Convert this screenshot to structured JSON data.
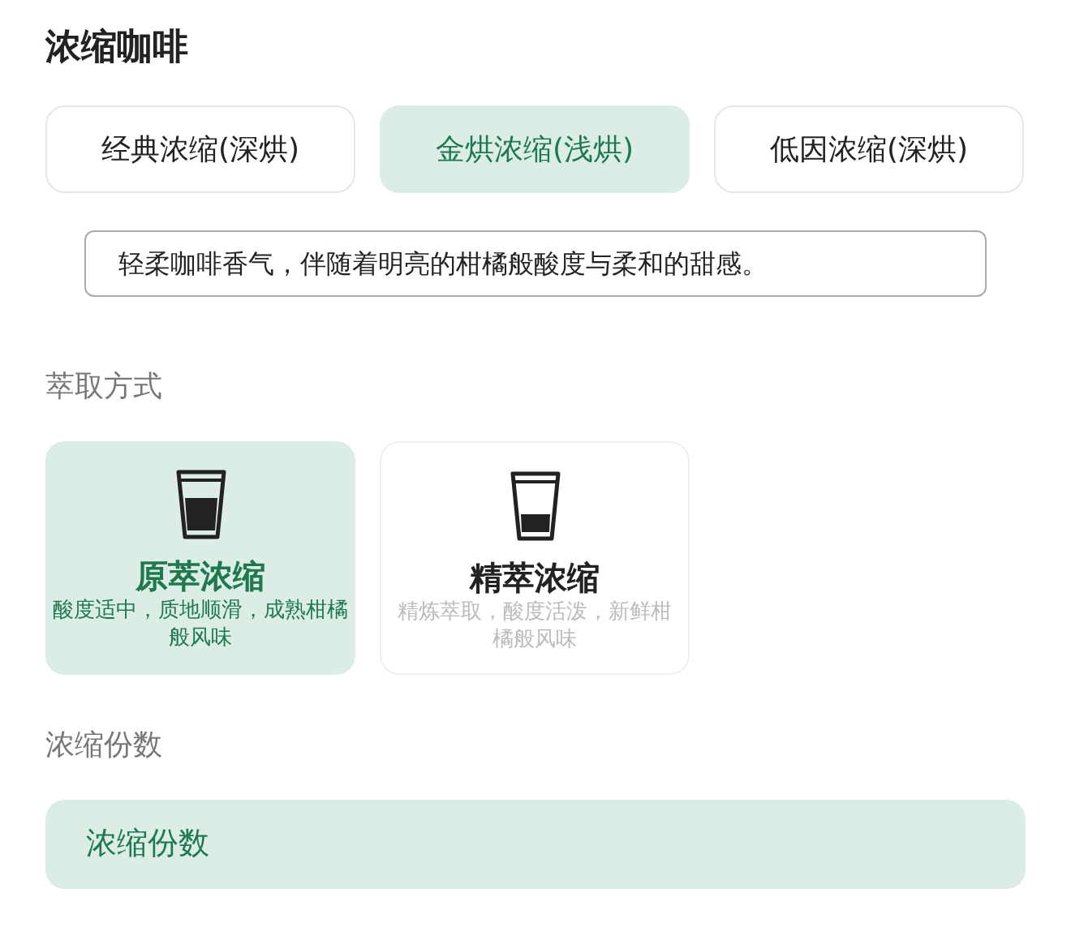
{
  "title": "浓缩咖啡",
  "roasts": [
    {
      "label": "经典浓缩(深烘)",
      "selected": false
    },
    {
      "label": "金烘浓缩(浅烘)",
      "selected": true
    },
    {
      "label": "低因浓缩(深烘)",
      "selected": false
    }
  ],
  "description": "轻柔咖啡香气，伴随着明亮的柑橘般酸度与柔和的甜感。",
  "extraction_label": "萃取方式",
  "methods": [
    {
      "kind": "full",
      "name": "原萃浓缩",
      "note": "酸度适中，质地顺滑，成熟柑橘般风味",
      "selected": true
    },
    {
      "kind": "low",
      "name": "精萃浓缩",
      "note": "精炼萃取，酸度活泼，新鲜柑橘般风味",
      "selected": false
    }
  ],
  "shots_label": "浓缩份数",
  "shots_bar": {
    "label": "浓缩份数"
  }
}
